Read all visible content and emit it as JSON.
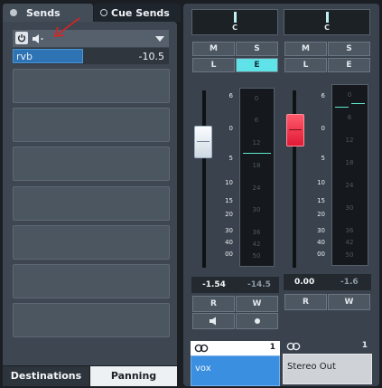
{
  "tabs": {
    "sends": "Sends",
    "cue_sends": "Cue Sends"
  },
  "sends": {
    "slot1": {
      "name": "rvb",
      "level": "-10.5",
      "level_fraction": 0.45
    },
    "empty_slot_count": 7
  },
  "bottom_tabs": {
    "destinations": "Destinations",
    "panning": "Panning"
  },
  "channels": [
    {
      "name": "vox",
      "pan": "C",
      "volume": "-1.54",
      "peak": "-14.5",
      "number": "1",
      "buttons": {
        "m": "M",
        "s": "S",
        "l": "L",
        "e": "E",
        "r": "R",
        "w": "W"
      }
    },
    {
      "name": "Stereo Out",
      "pan": "C",
      "volume": "0.00",
      "peak": "-1.6",
      "number": "1",
      "buttons": {
        "m": "M",
        "s": "S",
        "l": "L",
        "e": "E",
        "r": "R",
        "w": "W"
      }
    }
  ],
  "fader_scale": [
    "6",
    "0",
    "5",
    "10",
    "15",
    "20",
    "30",
    "40",
    "00"
  ],
  "meter_scale": [
    "0",
    "6",
    "12",
    "18",
    "24",
    "30",
    "36",
    "42",
    "50"
  ],
  "colors": {
    "accent": "#5fe3e8",
    "vox_name_bg": "#3b8fe0",
    "fader_vox": "#e8eef4",
    "fader_stereo": "#ff2a45",
    "send_fill": "#2e73b4"
  },
  "icons": {
    "power": "power-icon",
    "speaker": "speaker-icon",
    "menu": "dropdown-triangle-icon",
    "link": "link-rings-icon",
    "monitor": "speaker-icon",
    "record": "record-dot-icon"
  }
}
